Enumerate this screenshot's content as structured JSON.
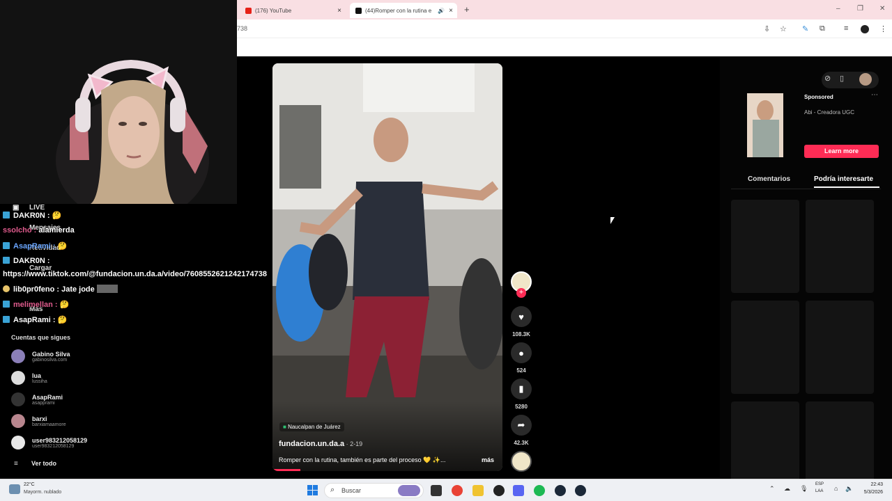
{
  "browser": {
    "tabs": [
      {
        "label": "(176) YouTube",
        "close": "×"
      },
      {
        "label": "(44)Romper con la rutina e",
        "close": "×"
      }
    ],
    "new_tab": "+",
    "url_partial": "738",
    "window_controls": {
      "minimize": "–",
      "restore": "❐",
      "close": "✕"
    }
  },
  "chat": {
    "lines": [
      {
        "user": "DAKR0N :",
        "text": "🤔",
        "color": "#ffffff"
      },
      {
        "user": "ssolcho :",
        "text": "alamierda",
        "color": "#e05b8d"
      },
      {
        "user": "AsapRami :",
        "text": "🤔",
        "color": "#6aa6ff"
      },
      {
        "user": "DAKR0N :",
        "text": "",
        "color": "#ffffff"
      },
      {
        "user": "",
        "text": "https://www.tiktok.com/@fundacion.un.da.a/video/7608552621242174738",
        "color": "#ffffff"
      },
      {
        "user": "lib0pr0feno :",
        "text": "Jate jode",
        "color": "#ffffff"
      },
      {
        "user": "melimellan :",
        "text": "🤔",
        "color": "#e05b8d"
      },
      {
        "user": "AsapRami :",
        "text": "🤔",
        "color": "#ffffff"
      }
    ]
  },
  "sidebar": {
    "nav": [
      {
        "label": "LIVE"
      },
      {
        "label": "Mensajes"
      },
      {
        "label": "Actividad"
      },
      {
        "label": "Cargar"
      },
      {
        "label": "Más"
      }
    ],
    "following_title": "Cuentas que sigues",
    "following": [
      {
        "name": "Gabino Silva",
        "handle": "gabinosilva.com"
      },
      {
        "name": "lua",
        "handle": "lussiha"
      },
      {
        "name": "AsapRami",
        "handle": "asapprami"
      },
      {
        "name": "barxi",
        "handle": "barxiamaamore"
      },
      {
        "name": "user983212058129",
        "handle": "user983212058129"
      }
    ],
    "see_all": "Ver todo"
  },
  "video": {
    "location": "Naucalpan de Juárez",
    "author": "fundacion.un.da.a",
    "date": "2-19",
    "caption": "Romper con la rutina, también es parte del proceso 💛 ✨...",
    "more": "más"
  },
  "actions": {
    "likes": "108.3K",
    "comments": "524",
    "saves": "5280",
    "shares": "42.3K"
  },
  "right_panel": {
    "sponsored": "Sponsored",
    "ad_name": "Abi - Creadora UGC",
    "learn_more": "Learn more",
    "tabs": [
      "Comentarios",
      "Podría interesarte"
    ],
    "accent": "#fe2c55"
  },
  "taskbar": {
    "weather_temp": "22°C",
    "weather_desc": "Mayorm. nublado",
    "search_placeholder": "Buscar",
    "lang": "ESP",
    "region": "LAA",
    "time": "22:43",
    "date": "5/3/2026"
  }
}
